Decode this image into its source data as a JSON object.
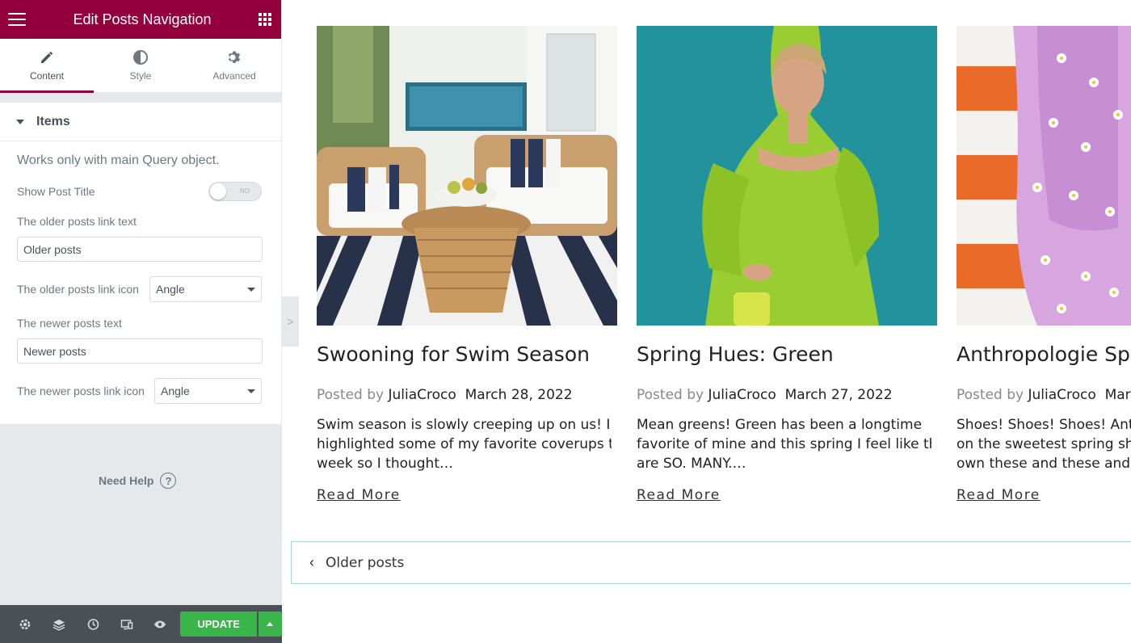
{
  "panel": {
    "header": {
      "title": "Edit Posts Navigation",
      "color": "#93003c"
    },
    "tabs": [
      {
        "label": "Content",
        "icon": "pencil-icon",
        "active": true
      },
      {
        "label": "Style",
        "icon": "half-circle-icon",
        "active": false
      },
      {
        "label": "Advanced",
        "icon": "gear-icon",
        "active": false
      }
    ],
    "section": {
      "label": "Items"
    },
    "note": "Works only with main Query object.",
    "show_post_title": {
      "label": "Show Post Title",
      "toggle_text": "NO",
      "value": false
    },
    "older_text": {
      "label": "The older posts link text",
      "value": "Older posts"
    },
    "older_icon": {
      "label": "The older posts link icon",
      "value": "Angle"
    },
    "newer_text": {
      "label": "The newer posts text",
      "value": "Newer posts"
    },
    "newer_icon": {
      "label": "The newer posts link icon",
      "value": "Angle"
    },
    "help": {
      "label": "Need Help",
      "icon": "question-icon"
    },
    "footer": {
      "icons": [
        "settings-icon",
        "layers-icon",
        "history-icon",
        "responsive-icon",
        "eye-icon"
      ],
      "update_label": "UPDATE",
      "update_color": "#39b54a"
    },
    "collapse_label": ">"
  },
  "posts": [
    {
      "title": "Swooning for Swim Season",
      "posted_by": "Posted by",
      "author": "JuliaCroco",
      "date": "March 28, 2022",
      "excerpt": [
        "Swim season is slowly creeping up on us! I",
        "highlighted some of my favorite coverups this",
        "week so I thought…"
      ],
      "read_more": "Read More"
    },
    {
      "title": "Spring Hues: Green",
      "posted_by": "Posted by",
      "author": "JuliaCroco",
      "date": "March 27, 2022",
      "excerpt": [
        "Mean greens! Green has been a longtime",
        "favorite of mine and this spring I feel like there",
        "are SO. MANY.…"
      ],
      "read_more": "Read More"
    },
    {
      "title": "Anthropologie Sprin",
      "posted_by": "Posted by",
      "author": "JuliaCroco",
      "date": "March",
      "excerpt": [
        "Shoes! Shoes! Shoes! Anthro",
        "on the sweetest spring shoe",
        "own these and these and al"
      ],
      "read_more": "Read More"
    }
  ],
  "pagination": {
    "label": "Older posts",
    "icon": "chevron-left-icon"
  }
}
